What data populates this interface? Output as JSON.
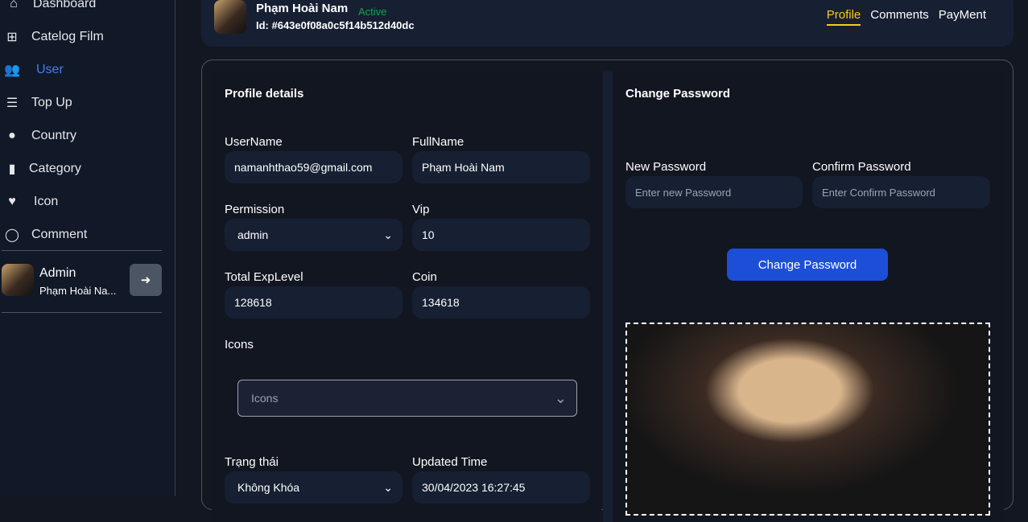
{
  "sidebar": {
    "items": [
      {
        "label": "Dashboard",
        "icon": "home-icon"
      },
      {
        "label": "Catelog Film",
        "icon": "grid-icon"
      },
      {
        "label": "User",
        "icon": "users-icon"
      },
      {
        "label": "Top Up",
        "icon": "coins-icon"
      },
      {
        "label": "Country",
        "icon": "globe-icon"
      },
      {
        "label": "Category",
        "icon": "book-icon"
      },
      {
        "label": "Icon",
        "icon": "icons-icon"
      },
      {
        "label": "Comment",
        "icon": "comment-icon"
      }
    ],
    "admin": {
      "role": "Admin",
      "name": "Phạm Hoài Na..."
    }
  },
  "header": {
    "name": "Phạm Hoài Nam",
    "status": "Active",
    "id": "Id: #643e0f08a0c5f14b512d40dc",
    "tabs": [
      "Profile",
      "Comments",
      "PayMent"
    ]
  },
  "profile": {
    "title": "Profile details",
    "username_label": "UserName",
    "username": "namanhthao59@gmail.com",
    "fullname_label": "FullName",
    "fullname": "Phạm Hoài Nam",
    "permission_label": "Permission",
    "permission": "admin",
    "vip_label": "Vip",
    "vip": "10",
    "exp_label": "Total ExpLevel",
    "exp": "128618",
    "coin_label": "Coin",
    "coin": "134618",
    "icons_label": "Icons",
    "icons_placeholder": "Icons",
    "status_label": "Trạng thái",
    "status": "Không Khóa",
    "updated_label": "Updated Time",
    "updated": "30/04/2023 16:27:45"
  },
  "password": {
    "title": "Change Password",
    "new_label": "New Password",
    "new_placeholder": "Enter new Password",
    "confirm_label": "Confirm Password",
    "confirm_placeholder": "Enter Confirm Password",
    "button": "Change Password"
  },
  "colors": {
    "accent": "#3b82f6",
    "button": "#1d4ed8",
    "active_tab": "#facc15",
    "status": "#16a34a"
  }
}
